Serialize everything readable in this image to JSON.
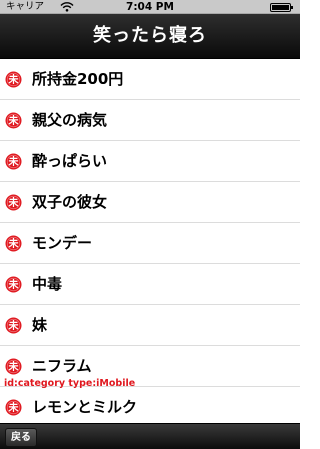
{
  "status_bar": {
    "carrier": "キャリア",
    "time": "7:04 PM",
    "wifi_icon": "wifi-icon",
    "battery_icon": "battery-icon"
  },
  "nav": {
    "title": "笑ったら寝ろ"
  },
  "colors": {
    "row_icon": "#e0181f",
    "debug_text": "#e0181f",
    "nav_background": "#111111"
  },
  "list": {
    "row_icon": "未",
    "items": [
      {
        "label": "所持金200円"
      },
      {
        "label": "親父の病気"
      },
      {
        "label": "酔っぱらい"
      },
      {
        "label": "双子の彼女"
      },
      {
        "label": "モンデー"
      },
      {
        "label": "中毒"
      },
      {
        "label": "妹"
      },
      {
        "label": "ニフラム"
      },
      {
        "label": "レモンとミルク"
      }
    ]
  },
  "debug": {
    "text": "id:category type:iMobile"
  },
  "toolbar": {
    "back_label": "戻る"
  }
}
